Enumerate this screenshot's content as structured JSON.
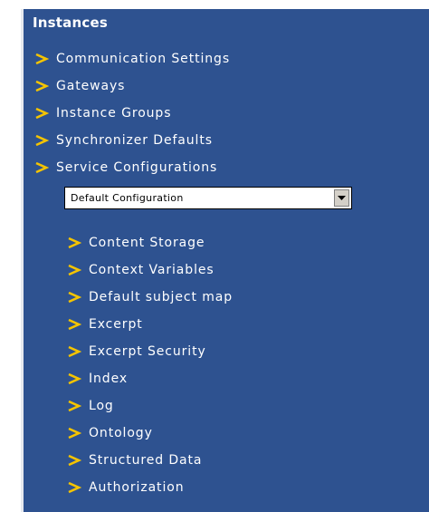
{
  "panel": {
    "title": "Instances",
    "items": [
      {
        "label": "Communication Settings"
      },
      {
        "label": "Gateways"
      },
      {
        "label": "Instance Groups"
      },
      {
        "label": "Synchronizer Defaults"
      },
      {
        "label": "Service Configurations"
      }
    ],
    "config_select": {
      "selected": "Default Configuration"
    },
    "sub_items": [
      {
        "label": "Content Storage"
      },
      {
        "label": "Context Variables"
      },
      {
        "label": "Default subject map"
      },
      {
        "label": "Excerpt"
      },
      {
        "label": "Excerpt Security"
      },
      {
        "label": "Index"
      },
      {
        "label": "Log"
      },
      {
        "label": "Ontology"
      },
      {
        "label": "Structured Data"
      },
      {
        "label": "Authorization"
      }
    ]
  },
  "colors": {
    "panel_background": "#2e5290",
    "chevron": "#f5c400",
    "text": "#ffffff"
  },
  "icons": {
    "item_bullet": "chevron-right-icon",
    "select_button": "dropdown-arrow-icon"
  }
}
